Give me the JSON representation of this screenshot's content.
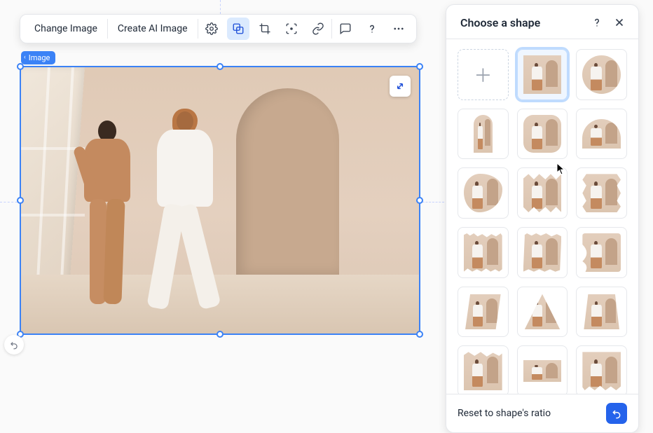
{
  "toolbar": {
    "change_image": "Change Image",
    "create_ai_image": "Create AI Image"
  },
  "badge": {
    "label": "Image"
  },
  "panel": {
    "title": "Choose a shape",
    "reset_label": "Reset to shape's ratio",
    "shapes": {
      "add": "Add custom shape",
      "square": "Square",
      "circle": "Circle",
      "arch": "Arch",
      "rounded": "Rounded square",
      "archwide": "Wide arch",
      "blob": "Blob",
      "zigzag": "Zigzag",
      "scallop": "Scallop",
      "torn": "Torn paper",
      "brush": "Brush stroke",
      "wave": "Wave",
      "para": "Parallelogram",
      "tri": "Triangle",
      "trap": "Trapezoid",
      "rough1": "Rough top",
      "rect": "Rectangle",
      "rough2": "Rough bottom"
    },
    "selected_shape": "square"
  }
}
